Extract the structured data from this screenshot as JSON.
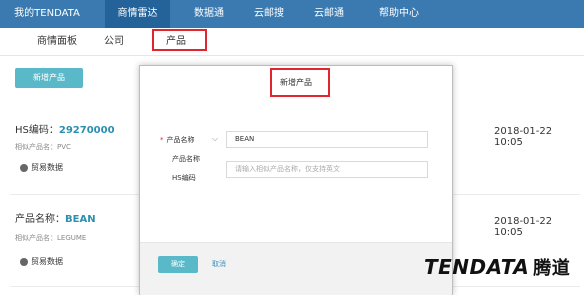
{
  "topnav": {
    "items": [
      "我的TENDATA",
      "商情雷达",
      "数据通",
      "云邮搜",
      "云邮通",
      "帮助中心"
    ]
  },
  "subnav": {
    "items": [
      "商情面板",
      "公司",
      "产品"
    ]
  },
  "add_product_button": "新增产品",
  "records": [
    {
      "title_label": "HS编码：",
      "title_value": "29270000",
      "similar": "相似产品名：PVC",
      "trade": "贸易数据",
      "date": "2018-01-22  10:05"
    },
    {
      "title_label": "产品名称：",
      "title_value": "BEAN",
      "similar": "相似产品名：LEGUME",
      "trade": "贸易数据",
      "date": "2018-01-22  10:05"
    }
  ],
  "modal": {
    "title": "新增产品",
    "required_mark": "*",
    "label_selected": "产品名称",
    "dropdown_options": [
      "产品名称",
      "HS编码"
    ],
    "input_value": "BEAN",
    "input_placeholder": "请输入相似产品名称，仅支持英文",
    "ok_label": "确定",
    "cancel_label": "取消"
  },
  "watermark": {
    "text": "TENDATA",
    "cn": "腾道"
  },
  "colors": {
    "topnav_bg": "#3a7ab0",
    "accent": "#5ab9c9",
    "highlight": "#e0262e"
  }
}
